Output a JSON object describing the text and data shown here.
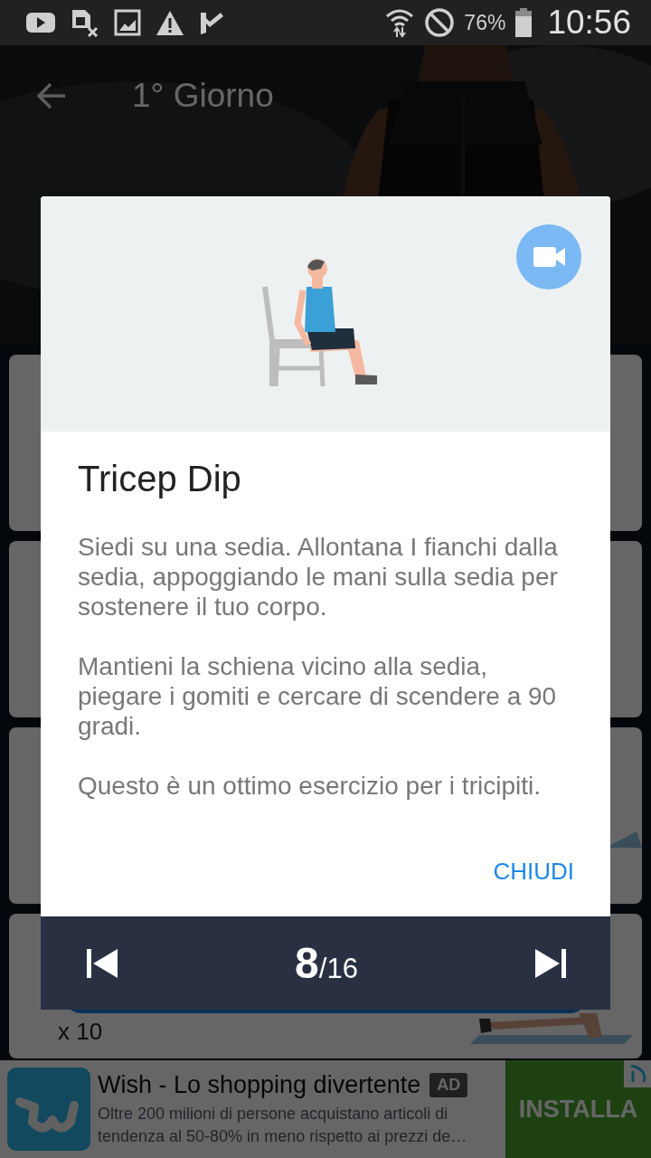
{
  "status_bar": {
    "battery": "76%",
    "time": "10:56"
  },
  "header": {
    "title": "1° Giorno"
  },
  "cards": [
    {
      "kind": "plain"
    },
    {
      "kind": "plain"
    },
    {
      "kind": "mat"
    },
    {
      "kind": "exercise",
      "count": "x 10"
    }
  ],
  "dialog": {
    "title": "Tricep Dip",
    "paragraphs": [
      "Siedi su una sedia. Allontana I fianchi dalla sedia, appoggiando le mani sulla sedia per sostenere il tuo corpo.",
      "Mantieni la schiena vicino alla sedia, piegare i gomiti e cercare di scendere a 90 gradi.",
      "Questo è un ottimo esercizio per i tricipiti."
    ],
    "close_label": "CHIUDI",
    "current": "8",
    "total": "/16"
  },
  "ad": {
    "title": "Wish - Lo shopping divertente",
    "badge": "AD",
    "text": "Oltre 200 milioni di persone acquistano articoli di tendenza al 50-80% in meno rispetto ai prezzi de…",
    "button": "INSTALLA"
  }
}
